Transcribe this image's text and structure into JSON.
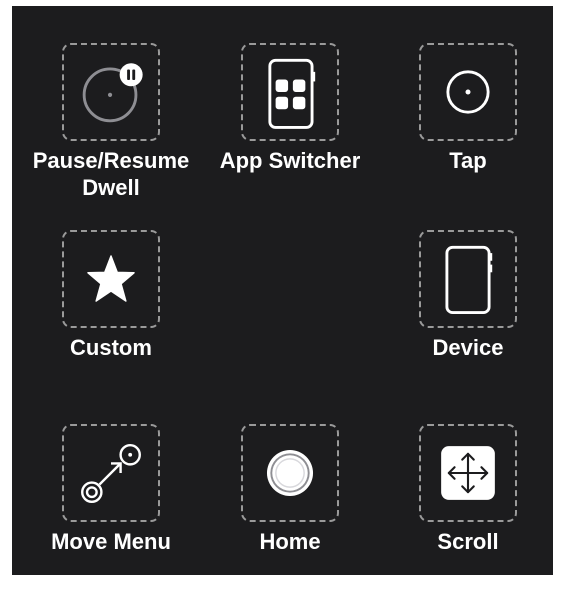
{
  "menu": {
    "items": [
      {
        "label_line1": "Pause/Resume",
        "label_line2": "Dwell",
        "icon": "pause-dwell-icon"
      },
      {
        "label_line1": "App Switcher",
        "icon": "app-switcher-icon"
      },
      {
        "label_line1": "Tap",
        "icon": "tap-icon"
      },
      {
        "label_line1": "Custom",
        "icon": "star-icon"
      },
      {
        "label_line1": "Device",
        "icon": "device-icon"
      },
      {
        "label_line1": "Move Menu",
        "icon": "move-menu-icon"
      },
      {
        "label_line1": "Home",
        "icon": "home-icon"
      },
      {
        "label_line1": "Scroll",
        "icon": "scroll-icon"
      }
    ]
  },
  "colors": {
    "background": "#1c1c1e",
    "tile_border": "#9a9a9a",
    "text": "#ffffff"
  }
}
